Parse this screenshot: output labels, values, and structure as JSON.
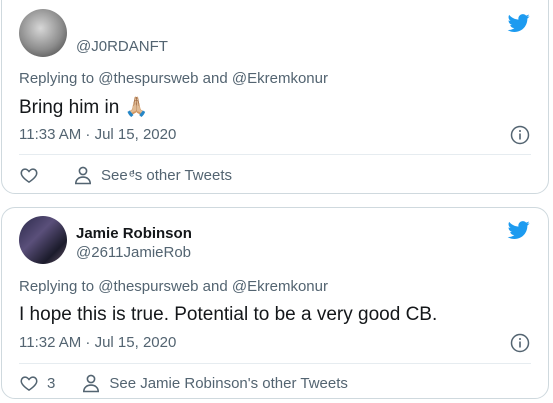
{
  "tweets": [
    {
      "display_name": "",
      "handle": "@J0RDANFT",
      "replying_prefix": "Replying to ",
      "reply_to_1": "@thespursweb",
      "reply_joiner": " and ",
      "reply_to_2": "@Ekremkonur",
      "text": "Bring him in 🙏🏼",
      "timestamp": "11:33 AM · Jul 15, 2020",
      "likes": "",
      "profile_link": "See ͤ's other Tweets"
    },
    {
      "display_name": "Jamie Robinson",
      "handle": "@2611JamieRob",
      "replying_prefix": "Replying to ",
      "reply_to_1": "@thespursweb",
      "reply_joiner": " and ",
      "reply_to_2": "@Ekremkonur",
      "text": "I hope this is true. Potential to be a very good CB.",
      "timestamp": "11:32 AM · Jul 15, 2020",
      "likes": "3",
      "profile_link": "See Jamie Robinson's other Tweets"
    }
  ],
  "colors": {
    "twitter_blue": "#1d9bf0",
    "muted": "#536471",
    "border": "#cfd9de"
  },
  "icons": [
    "twitter-bird-icon",
    "info-icon",
    "heart-icon",
    "person-icon"
  ]
}
